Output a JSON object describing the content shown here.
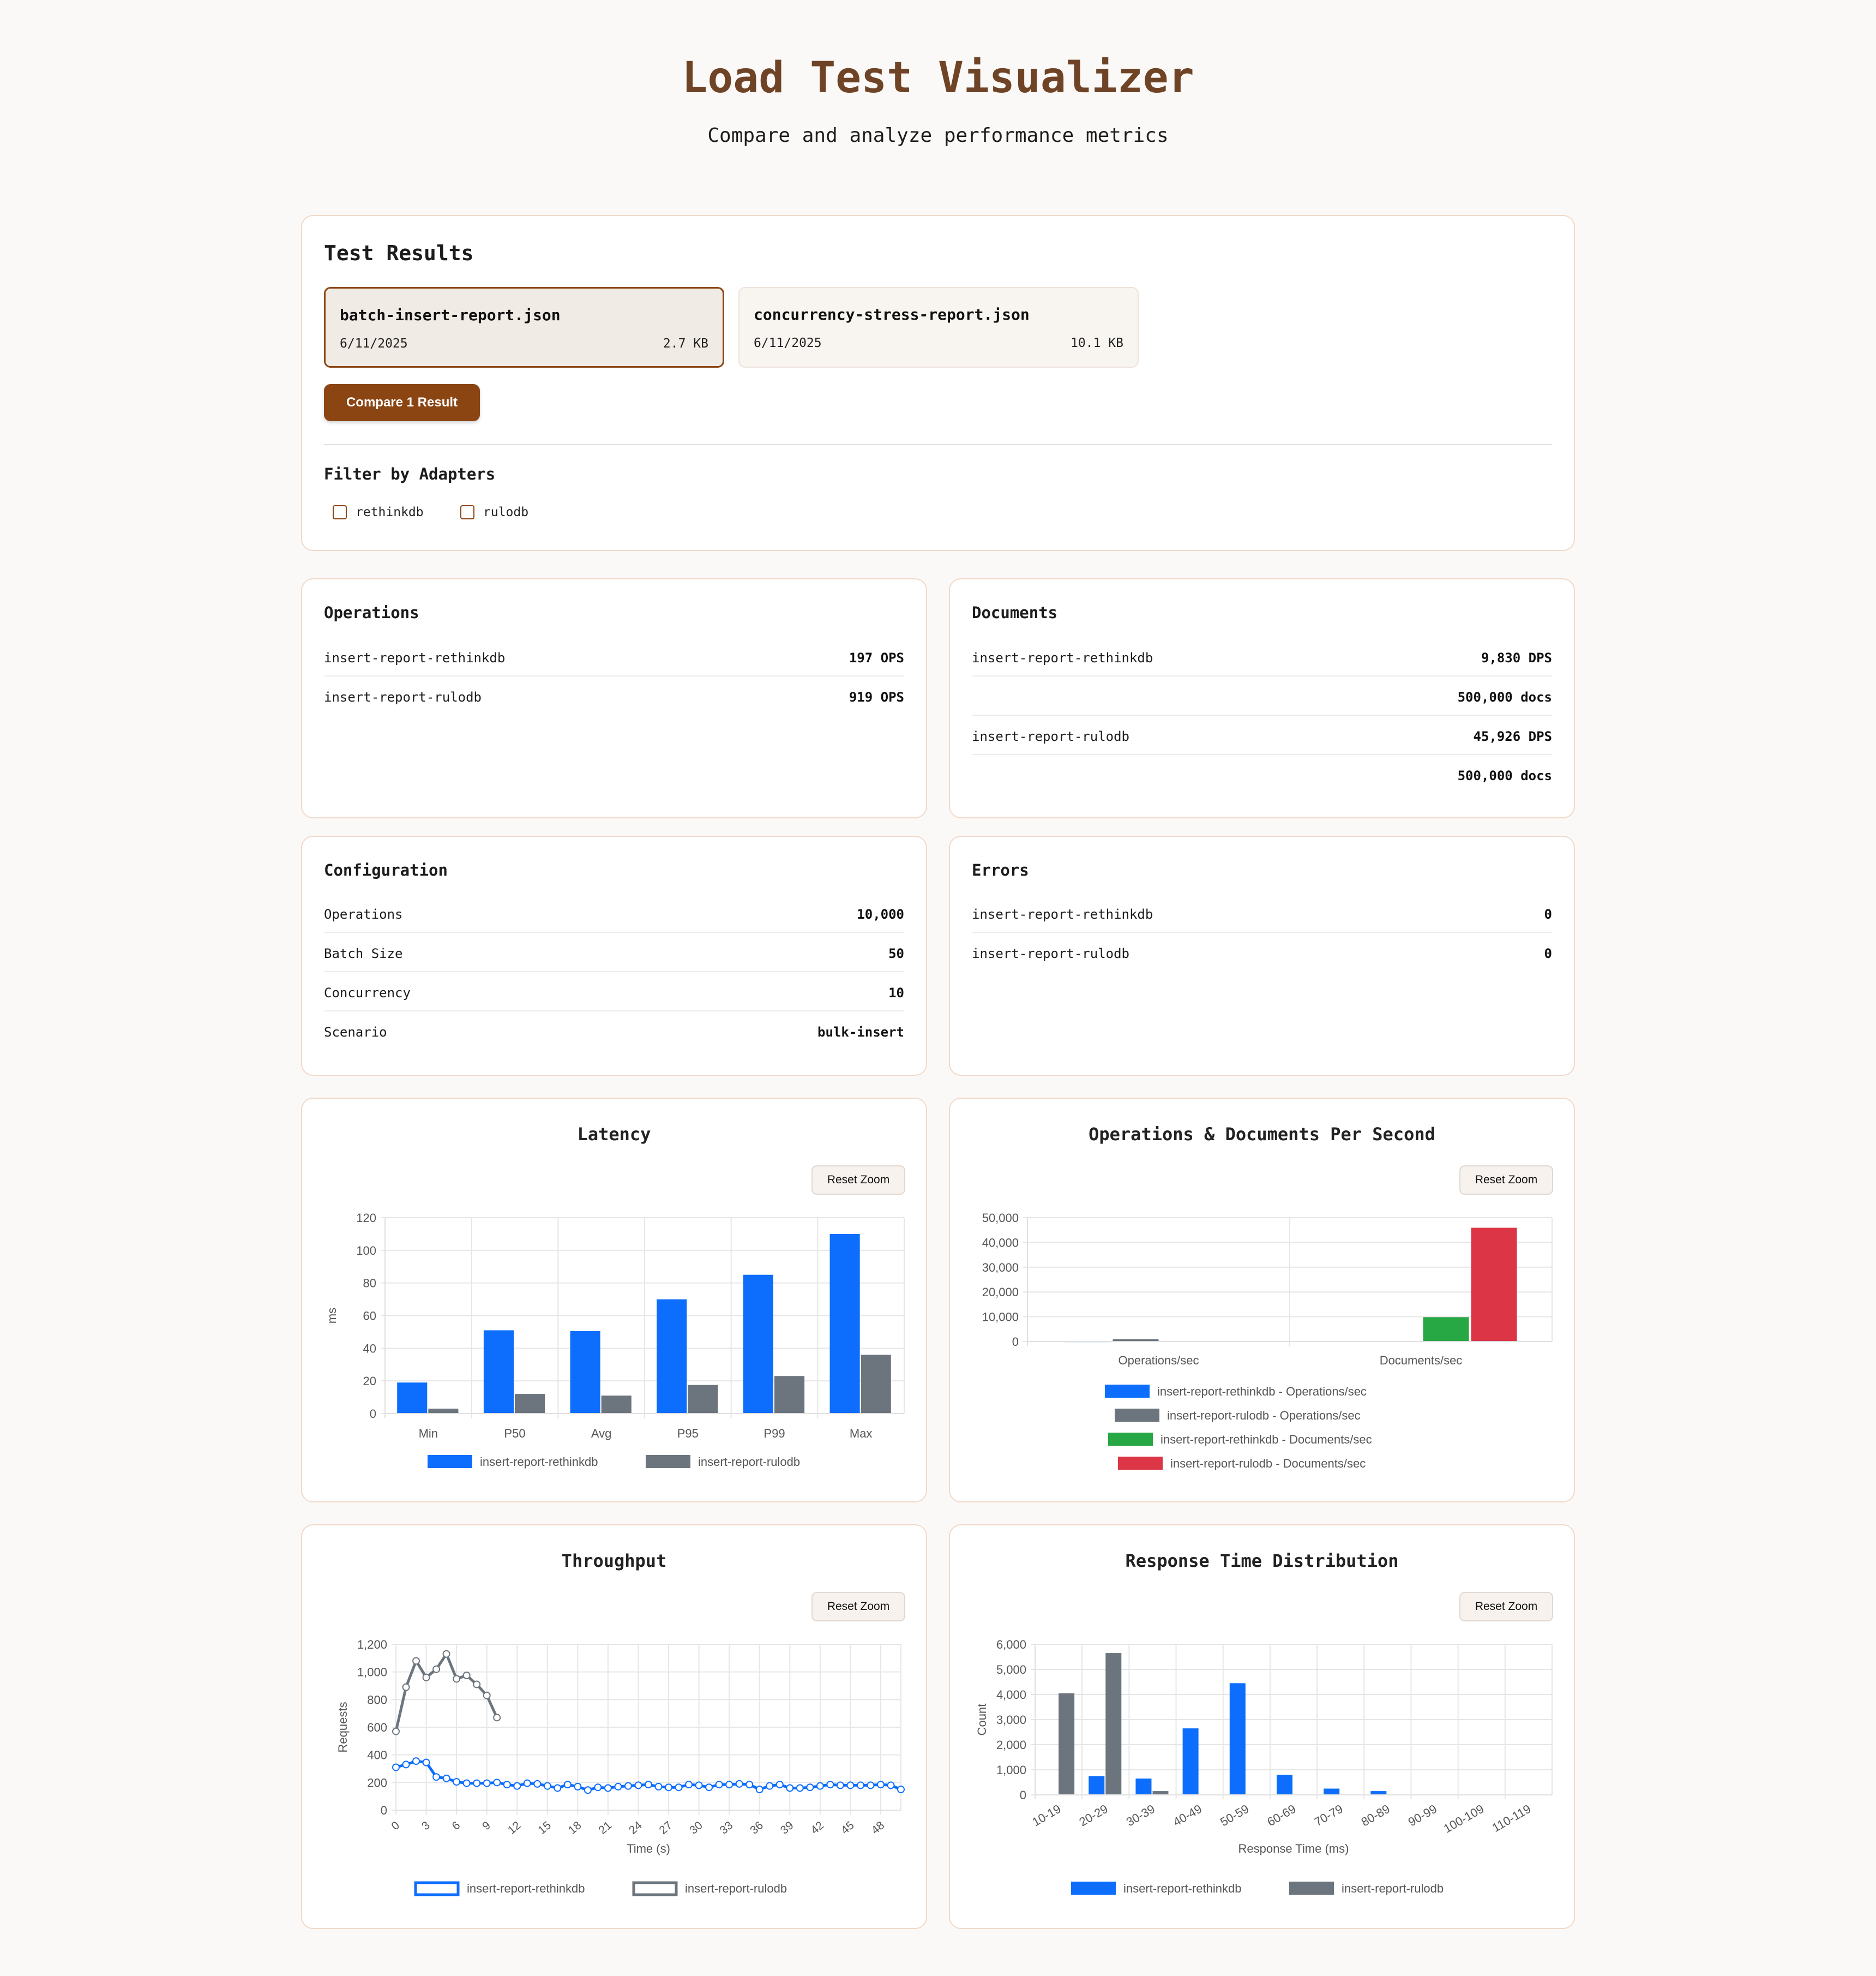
{
  "header": {
    "title": "Load Test Visualizer",
    "subtitle": "Compare and analyze performance metrics"
  },
  "test_results": {
    "title": "Test Results",
    "files": [
      {
        "name": "batch-insert-report.json",
        "date": "6/11/2025",
        "size": "2.7 KB",
        "selected": true
      },
      {
        "name": "concurrency-stress-report.json",
        "date": "6/11/2025",
        "size": "10.1 KB",
        "selected": false
      }
    ],
    "compare_label": "Compare 1 Result",
    "filter_title": "Filter by Adapters",
    "adapters": [
      "rethinkdb",
      "rulodb"
    ]
  },
  "operations": {
    "title": "Operations",
    "rows": [
      {
        "k": "insert-report-rethinkdb",
        "v": "197 OPS"
      },
      {
        "k": "insert-report-rulodb",
        "v": "919 OPS"
      }
    ]
  },
  "documents": {
    "title": "Documents",
    "rows": [
      {
        "k": "insert-report-rethinkdb",
        "v": "9,830 DPS"
      },
      {
        "k": "",
        "v": "500,000 docs"
      },
      {
        "k": "insert-report-rulodb",
        "v": "45,926 DPS"
      },
      {
        "k": "",
        "v": "500,000 docs"
      }
    ]
  },
  "configuration": {
    "title": "Configuration",
    "rows": [
      {
        "k": "Operations",
        "v": "10,000"
      },
      {
        "k": "Batch Size",
        "v": "50"
      },
      {
        "k": "Concurrency",
        "v": "10"
      },
      {
        "k": "Scenario",
        "v": "bulk-insert"
      }
    ]
  },
  "errors": {
    "title": "Errors",
    "rows": [
      {
        "k": "insert-report-rethinkdb",
        "v": "0"
      },
      {
        "k": "insert-report-rulodb",
        "v": "0"
      }
    ]
  },
  "reset_zoom_label": "Reset Zoom",
  "colors": {
    "accent": "#8b4513",
    "title": "#6f4426",
    "blue": "#0d6efd",
    "gray": "#6c757d",
    "green": "#28a745",
    "red": "#dc3545"
  },
  "chart_data": [
    {
      "type": "bar",
      "title": "Latency",
      "categories": [
        "Min",
        "P50",
        "Avg",
        "P95",
        "P99",
        "Max"
      ],
      "series": [
        {
          "name": "insert-report-rethinkdb",
          "values": [
            19,
            51,
            50.5,
            70,
            85,
            110
          ],
          "color": "#0d6efd"
        },
        {
          "name": "insert-report-rulodb",
          "values": [
            3,
            12,
            11,
            17.5,
            23,
            36
          ],
          "color": "#6c757d"
        }
      ],
      "xlabel": "",
      "ylabel": "ms",
      "ylim": [
        0,
        120
      ],
      "yticks": [
        0,
        20,
        40,
        60,
        80,
        100,
        120
      ],
      "ytick_labels": [
        "0",
        "20",
        "40",
        "60",
        "80",
        "100",
        "120"
      ],
      "grid": true,
      "legend": "bottom"
    },
    {
      "type": "bar",
      "title": "Operations & Documents Per Second",
      "categories": [
        "Operations/sec",
        "Documents/sec"
      ],
      "series": [
        {
          "name": "insert-report-rethinkdb - Operations/sec",
          "values": [
            197,
            null
          ],
          "color": "#0d6efd"
        },
        {
          "name": "insert-report-rulodb - Operations/sec",
          "values": [
            919,
            null
          ],
          "color": "#6c757d"
        },
        {
          "name": "insert-report-rethinkdb - Documents/sec",
          "values": [
            null,
            9830
          ],
          "color": "#28a745"
        },
        {
          "name": "insert-report-rulodb - Documents/sec",
          "values": [
            null,
            45926
          ],
          "color": "#dc3545"
        }
      ],
      "xlabel": "",
      "ylabel": "",
      "ylim": [
        0,
        50000
      ],
      "yticks": [
        0,
        10000,
        20000,
        30000,
        40000,
        50000
      ],
      "ytick_labels": [
        "0",
        "10,000",
        "20,000",
        "30,000",
        "40,000",
        "50,000"
      ],
      "grid": true,
      "legend": "bottom"
    },
    {
      "type": "line",
      "title": "Throughput",
      "x": [
        0,
        1,
        2,
        3,
        4,
        5,
        6,
        7,
        8,
        9,
        10,
        11,
        12,
        13,
        14,
        15,
        16,
        17,
        18,
        19,
        20,
        21,
        22,
        23,
        24,
        25,
        26,
        27,
        28,
        29,
        30,
        31,
        32,
        33,
        34,
        35,
        36,
        37,
        38,
        39,
        40,
        41,
        42,
        43,
        44,
        45,
        46,
        47,
        48,
        49,
        50
      ],
      "xticks": [
        0,
        3,
        6,
        9,
        12,
        15,
        18,
        21,
        24,
        27,
        30,
        33,
        36,
        39,
        42,
        45,
        48
      ],
      "series": [
        {
          "name": "insert-report-rethinkdb",
          "color": "#0d6efd",
          "values": [
            310,
            330,
            355,
            345,
            240,
            230,
            205,
            195,
            195,
            195,
            200,
            185,
            175,
            195,
            190,
            175,
            160,
            185,
            170,
            145,
            165,
            160,
            170,
            175,
            180,
            185,
            170,
            165,
            165,
            185,
            180,
            165,
            185,
            185,
            190,
            185,
            150,
            175,
            185,
            160,
            160,
            165,
            175,
            185,
            180,
            180,
            180,
            180,
            185,
            180,
            150
          ]
        },
        {
          "name": "insert-report-rulodb",
          "color": "#6c757d",
          "values": [
            570,
            890,
            1080,
            960,
            1020,
            1130,
            950,
            975,
            910,
            830,
            670
          ]
        }
      ],
      "xlabel": "Time (s)",
      "ylabel": "Requests",
      "ylim": [
        0,
        1200
      ],
      "yticks": [
        0,
        200,
        400,
        600,
        800,
        1000,
        1200
      ],
      "ytick_labels": [
        "0",
        "200",
        "400",
        "600",
        "800",
        "1,000",
        "1,200"
      ],
      "grid": true,
      "legend": "bottom"
    },
    {
      "type": "bar",
      "title": "Response Time Distribution",
      "categories": [
        "10-19",
        "20-29",
        "30-39",
        "40-49",
        "50-59",
        "60-69",
        "70-79",
        "80-89",
        "90-99",
        "100-109",
        "110-119"
      ],
      "series": [
        {
          "name": "insert-report-rethinkdb",
          "values": [
            0,
            750,
            650,
            2650,
            4450,
            800,
            250,
            150,
            20,
            10,
            10
          ],
          "color": "#0d6efd"
        },
        {
          "name": "insert-report-rulodb",
          "values": [
            4050,
            5650,
            150,
            0,
            0,
            0,
            0,
            0,
            0,
            0,
            0
          ],
          "color": "#6c757d"
        }
      ],
      "xlabel": "Response Time (ms)",
      "ylabel": "Count",
      "ylim": [
        0,
        6000
      ],
      "yticks": [
        0,
        1000,
        2000,
        3000,
        4000,
        5000,
        6000
      ],
      "ytick_labels": [
        "0",
        "1,000",
        "2,000",
        "3,000",
        "4,000",
        "5,000",
        "6,000"
      ],
      "grid": true,
      "legend": "bottom"
    }
  ]
}
